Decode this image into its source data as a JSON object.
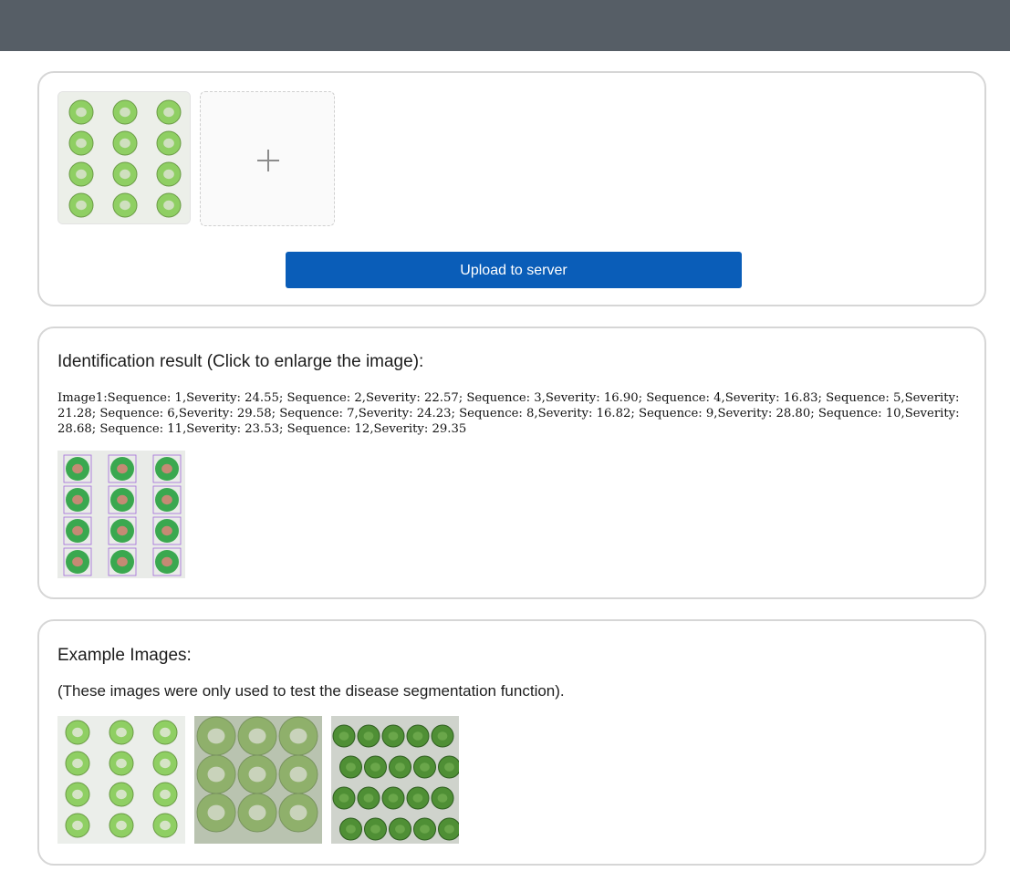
{
  "upload": {
    "button_label": "Upload to server",
    "uploaded_image_icon": "leaf-disc-photo",
    "add_icon": "plus-icon"
  },
  "result": {
    "heading": "Identification result (Click to enlarge the image):",
    "text": "Image1:Sequence: 1,Severity: 24.55; Sequence: 2,Severity: 22.57; Sequence: 3,Severity: 16.90; Sequence: 4,Severity: 16.83; Sequence: 5,Severity: 21.28; Sequence: 6,Severity: 29.58; Sequence: 7,Severity: 24.23; Sequence: 8,Severity: 16.82; Sequence: 9,Severity: 28.80; Sequence: 10,Severity: 28.68; Sequence: 11,Severity: 23.53; Sequence: 12,Severity: 29.35"
  },
  "examples": {
    "heading": "Example Images:",
    "note": "(These images were only used to test the disease segmentation function)."
  },
  "colors": {
    "topbar": "#565e66",
    "button": "#0a5db8",
    "leaf_light": "#8fcf63",
    "leaf_bright": "#3aa84f",
    "leaf_dark": "#4f8f35"
  }
}
